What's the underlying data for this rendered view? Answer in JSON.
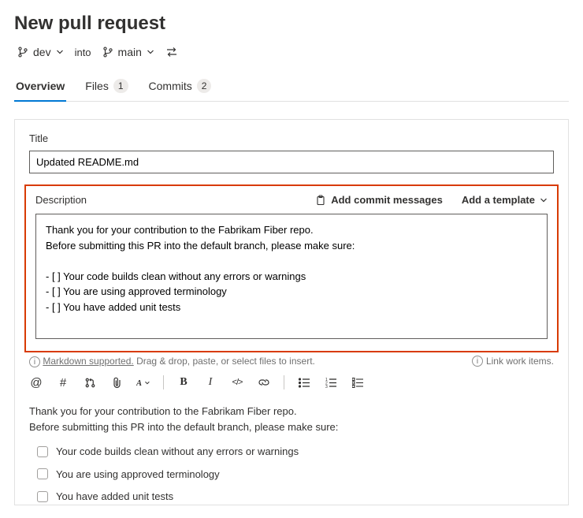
{
  "pageTitle": "New pull request",
  "source": "dev",
  "into": "into",
  "target": "main",
  "tabs": {
    "overview": "Overview",
    "files": {
      "label": "Files",
      "count": "1"
    },
    "commits": {
      "label": "Commits",
      "count": "2"
    }
  },
  "titleField": {
    "label": "Title",
    "value": "Updated README.md"
  },
  "desc": {
    "label": "Description",
    "addCommit": "Add commit messages",
    "addTemplate": "Add a template",
    "raw": "Thank you for your contribution to the Fabrikam Fiber repo.\nBefore submitting this PR into the default branch, please make sure:\n\n- [ ] Your code builds clean without any errors or warnings\n- [ ] You are using approved terminology\n- [ ] You have added unit tests"
  },
  "hints": {
    "md": "Markdown supported.",
    "drop": "Drag & drop, paste, or select files to insert.",
    "link": "Link work items."
  },
  "preview": {
    "p1": "Thank you for your contribution to the Fabrikam Fiber repo.",
    "p2": "Before submitting this PR into the default branch, please make sure:",
    "c1": "Your code builds clean without any errors or warnings",
    "c2": "You are using approved terminology",
    "c3": "You have added unit tests"
  }
}
